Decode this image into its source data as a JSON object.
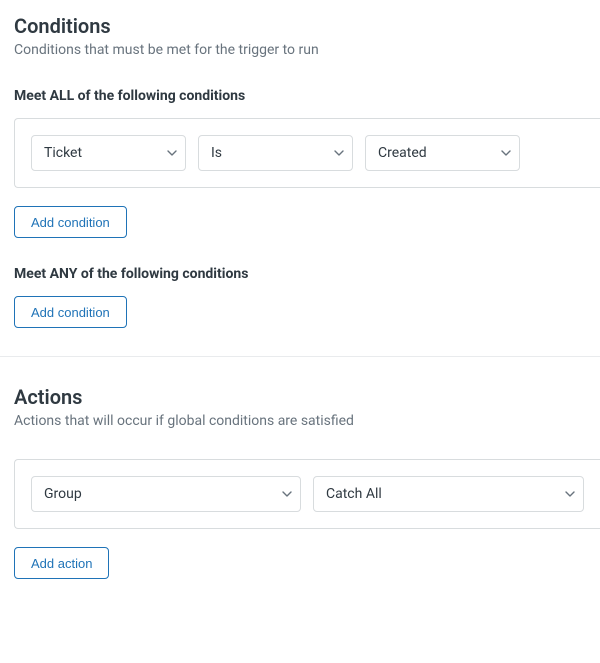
{
  "conditions": {
    "title": "Conditions",
    "desc": "Conditions that must be met for the trigger to run",
    "all": {
      "label": "Meet ALL of the following conditions",
      "rows": [
        {
          "field": "Ticket",
          "op": "Is",
          "value": "Created"
        }
      ],
      "add_label": "Add condition"
    },
    "any": {
      "label": "Meet ANY of the following conditions",
      "add_label": "Add condition"
    }
  },
  "actions": {
    "title": "Actions",
    "desc": "Actions that will occur if global conditions are satisfied",
    "rows": [
      {
        "field": "Group",
        "value": "Catch All"
      }
    ],
    "add_label": "Add action"
  }
}
